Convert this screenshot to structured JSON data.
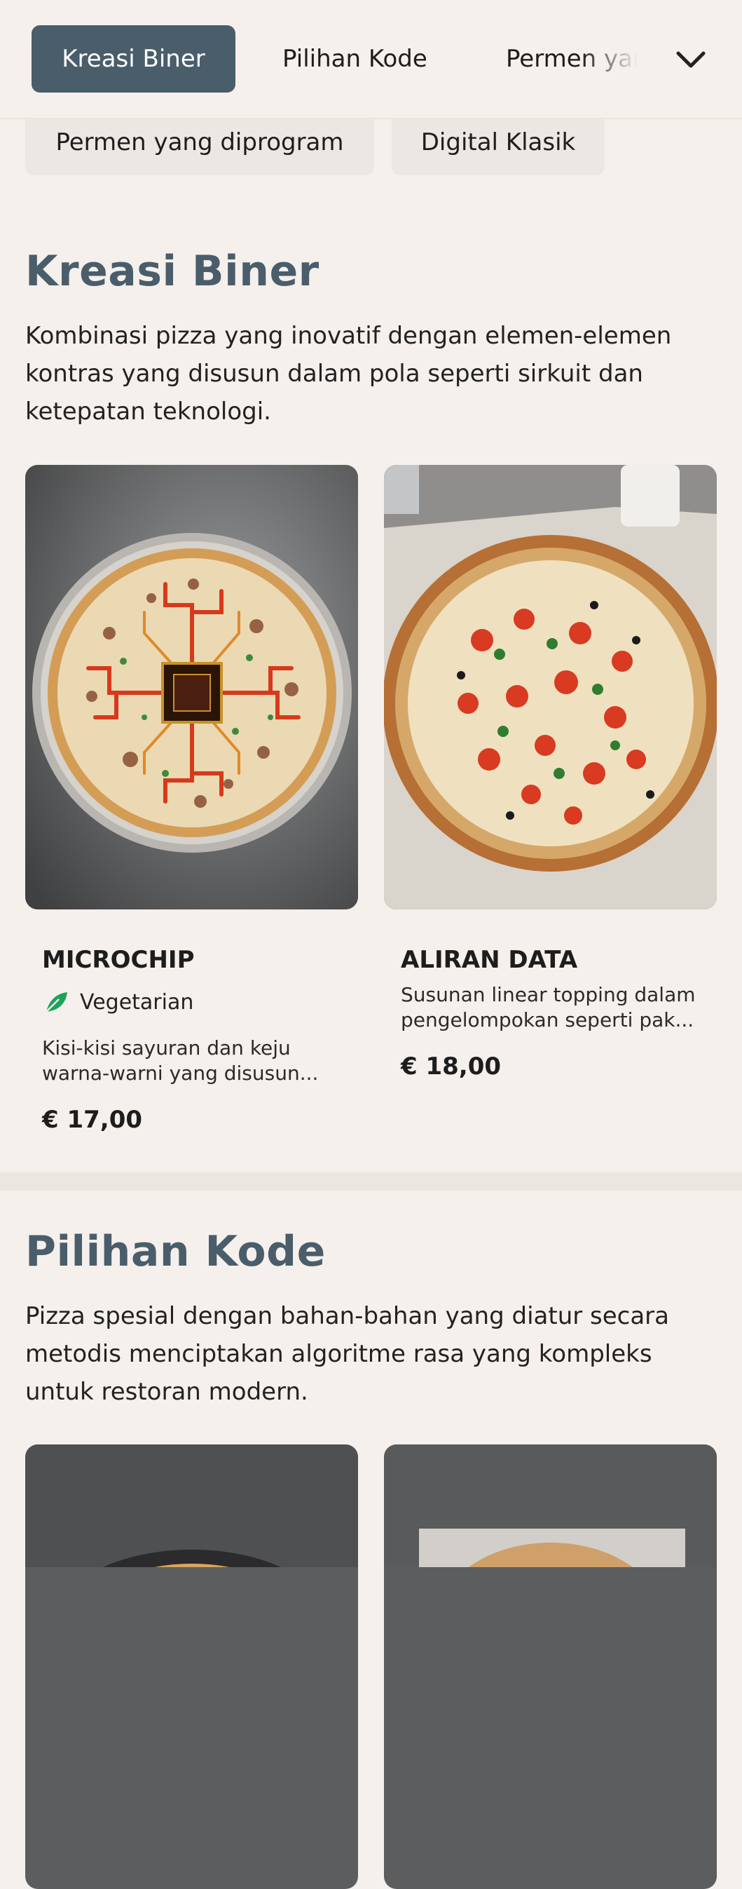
{
  "nav": {
    "tabs": [
      {
        "label": "Kreasi Biner",
        "active": true
      },
      {
        "label": "Pilihan Kode",
        "active": false
      },
      {
        "label": "Permen yang diprogram",
        "active": false
      }
    ],
    "overflow_chips": [
      "Permen yang diprogram",
      "Digital Klasik"
    ],
    "expand_icon": "chevron-down-icon"
  },
  "sections": [
    {
      "title": "Kreasi Biner",
      "description": "Kombinasi pizza yang inovatif dengan elemen-elemen kontras yang disusun dalam pola seperti sirkuit dan ketepatan teknologi.",
      "items": [
        {
          "name": "MICROCHIP",
          "tag": "Vegetarian",
          "tag_icon": "vegetarian-leaf-icon",
          "description": "Kisi-kisi sayuran dan keju warna-warni yang disusun...",
          "price": "€ 17,00"
        },
        {
          "name": "ALIRAN DATA",
          "description": "Susunan linear topping dalam pengelompokan seperti pak...",
          "price": "€ 18,00"
        }
      ]
    },
    {
      "title": "Pilihan Kode",
      "description": "Pizza spesial dengan bahan-bahan yang diatur secara metodis menciptakan algoritme rasa yang kompleks untuk restoran modern."
    }
  ],
  "colors": {
    "accent": "#4a5d6b",
    "background": "#f5f0ec",
    "chip": "#ede7e3",
    "vegetarian": "#1aa35a"
  }
}
